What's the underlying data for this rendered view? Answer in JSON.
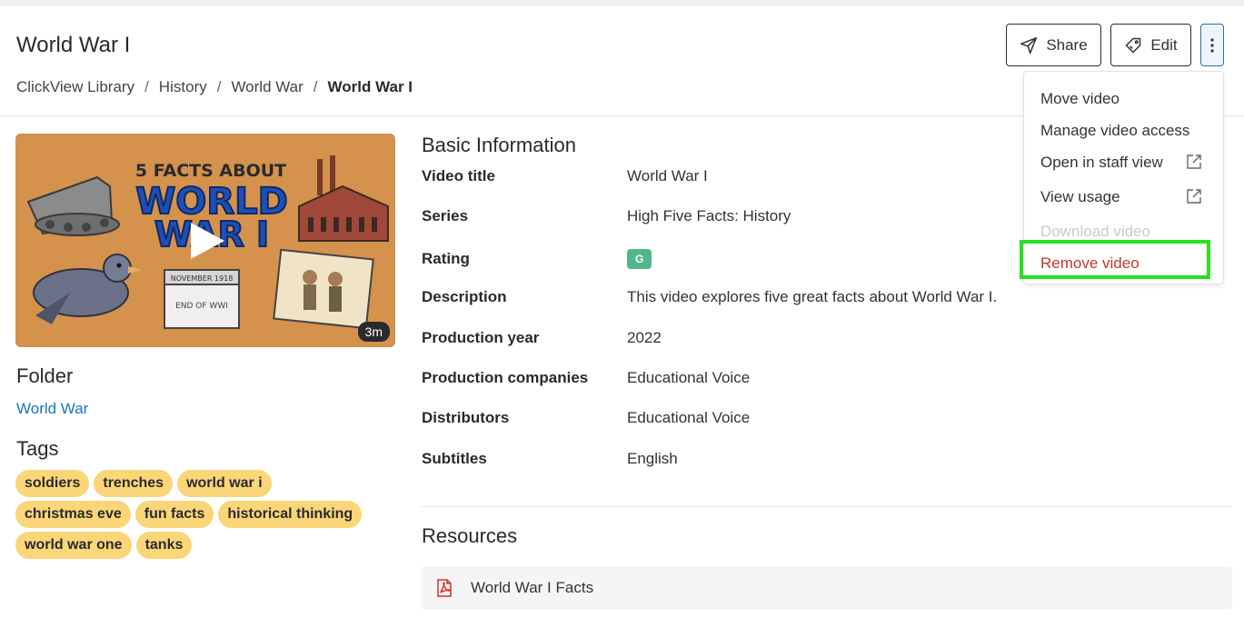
{
  "header": {
    "title": "World War I",
    "breadcrumb": [
      "ClickView Library",
      "History",
      "World War",
      "World War I"
    ],
    "share_label": "Share",
    "edit_label": "Edit"
  },
  "menu": {
    "items": [
      {
        "label": "Move video",
        "external": false,
        "state": "normal"
      },
      {
        "label": "Manage video access",
        "external": false,
        "state": "normal"
      },
      {
        "label": "Open in staff view",
        "external": true,
        "state": "normal"
      },
      {
        "label": "View usage",
        "external": true,
        "state": "normal"
      },
      {
        "label": "Download video",
        "external": false,
        "state": "disabled"
      },
      {
        "label": "Remove video",
        "external": false,
        "state": "danger"
      }
    ]
  },
  "video": {
    "thumbnail_text_line1": "5 FACTS ABOUT",
    "thumbnail_text_line2": "WORLD",
    "thumbnail_text_line3": "WAR I",
    "calendar_top": "NOVEMBER 1918",
    "calendar_bottom": "END OF WWI",
    "duration": "3m"
  },
  "folder": {
    "heading": "Folder",
    "link": "World War"
  },
  "tags": {
    "heading": "Tags",
    "rows": [
      [
        "soldiers",
        "trenches",
        "world war i"
      ],
      [
        "christmas eve",
        "fun facts",
        "historical thinking"
      ],
      [
        "world war one",
        "tanks"
      ]
    ]
  },
  "info": {
    "heading": "Basic Information",
    "video_title_k": "Video title",
    "video_title_v": "World War I",
    "series_k": "Series",
    "series_v": "High Five Facts: History",
    "rating_k": "Rating",
    "rating_v": "G",
    "description_k": "Description",
    "description_v": "This video explores five great facts about World War I.",
    "year_k": "Production year",
    "year_v": "2022",
    "companies_k": "Production companies",
    "companies_v": "Educational Voice",
    "distributors_k": "Distributors",
    "distributors_v": "Educational Voice",
    "subtitles_k": "Subtitles",
    "subtitles_v": "English"
  },
  "resources": {
    "heading": "Resources",
    "items": [
      "World War I Facts"
    ]
  },
  "colors": {
    "accent_link": "#1a73c8",
    "danger": "#c0392b",
    "tag_bg": "#fad679",
    "rating_bg": "#52b788",
    "highlight": "#29e01e"
  }
}
